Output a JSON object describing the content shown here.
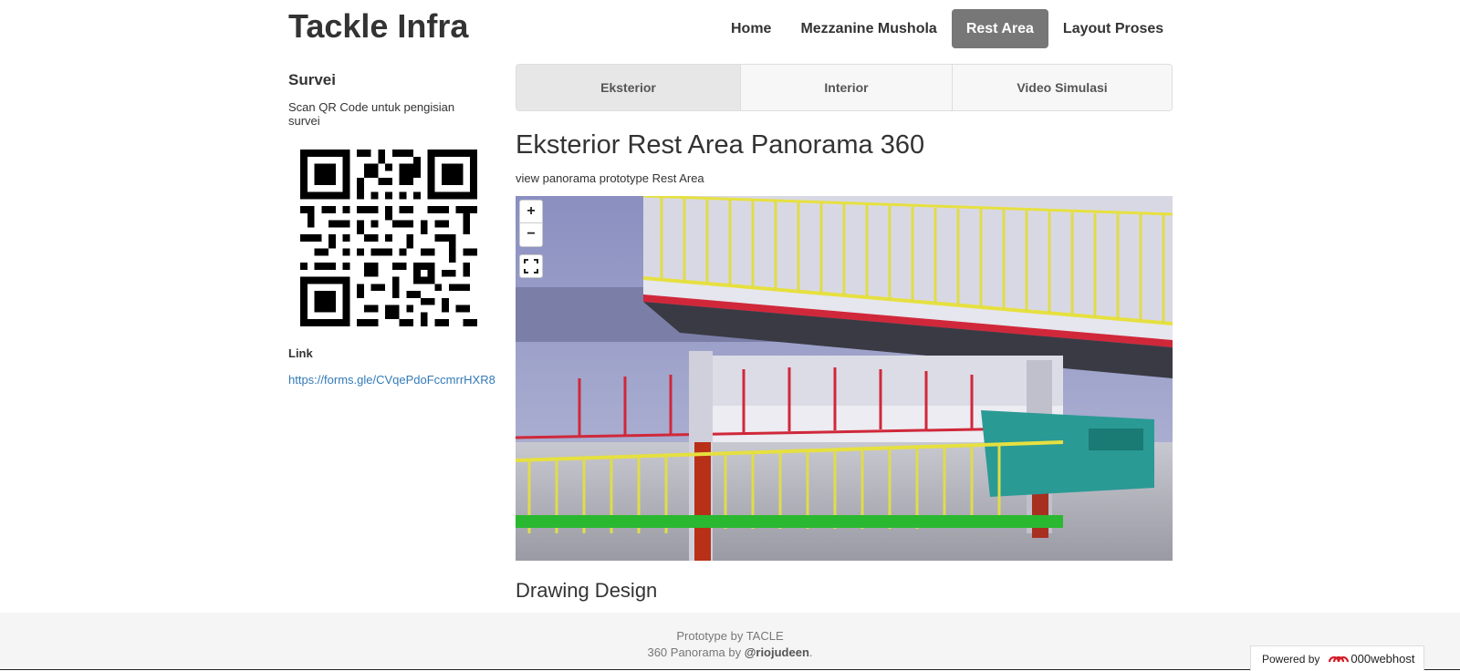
{
  "brand": "Tackle Infra",
  "nav": [
    {
      "label": "Home",
      "active": false
    },
    {
      "label": "Mezzanine Mushola",
      "active": false
    },
    {
      "label": "Rest Area",
      "active": true
    },
    {
      "label": "Layout Proses",
      "active": false
    }
  ],
  "sidebar": {
    "title": "Survei",
    "description": "Scan QR Code untuk pengisian survei",
    "link_label": "Link",
    "link_url": "https://forms.gle/CVqePdoFccmrrHXR8"
  },
  "tabs": [
    {
      "label": "Eksterior",
      "active": true
    },
    {
      "label": "Interior",
      "active": false
    },
    {
      "label": "Video Simulasi",
      "active": false
    }
  ],
  "main": {
    "heading": "Eksterior Rest Area Panorama 360",
    "subtitle": "view panorama prototype Rest Area",
    "section2": "Drawing Design"
  },
  "panorama_controls": {
    "zoom_in": "+",
    "zoom_out": "−"
  },
  "footer": {
    "line1": "Prototype by TACLE",
    "line2_prefix": "360 Panorama by ",
    "line2_author": "@riojudeen",
    "line2_suffix": "."
  },
  "hosting_badge": {
    "prefix": "Powered by",
    "name": "000webhost"
  },
  "icons": [
    "fullscreen-icon",
    "qr-code-icon",
    "webhost-logo-icon"
  ]
}
